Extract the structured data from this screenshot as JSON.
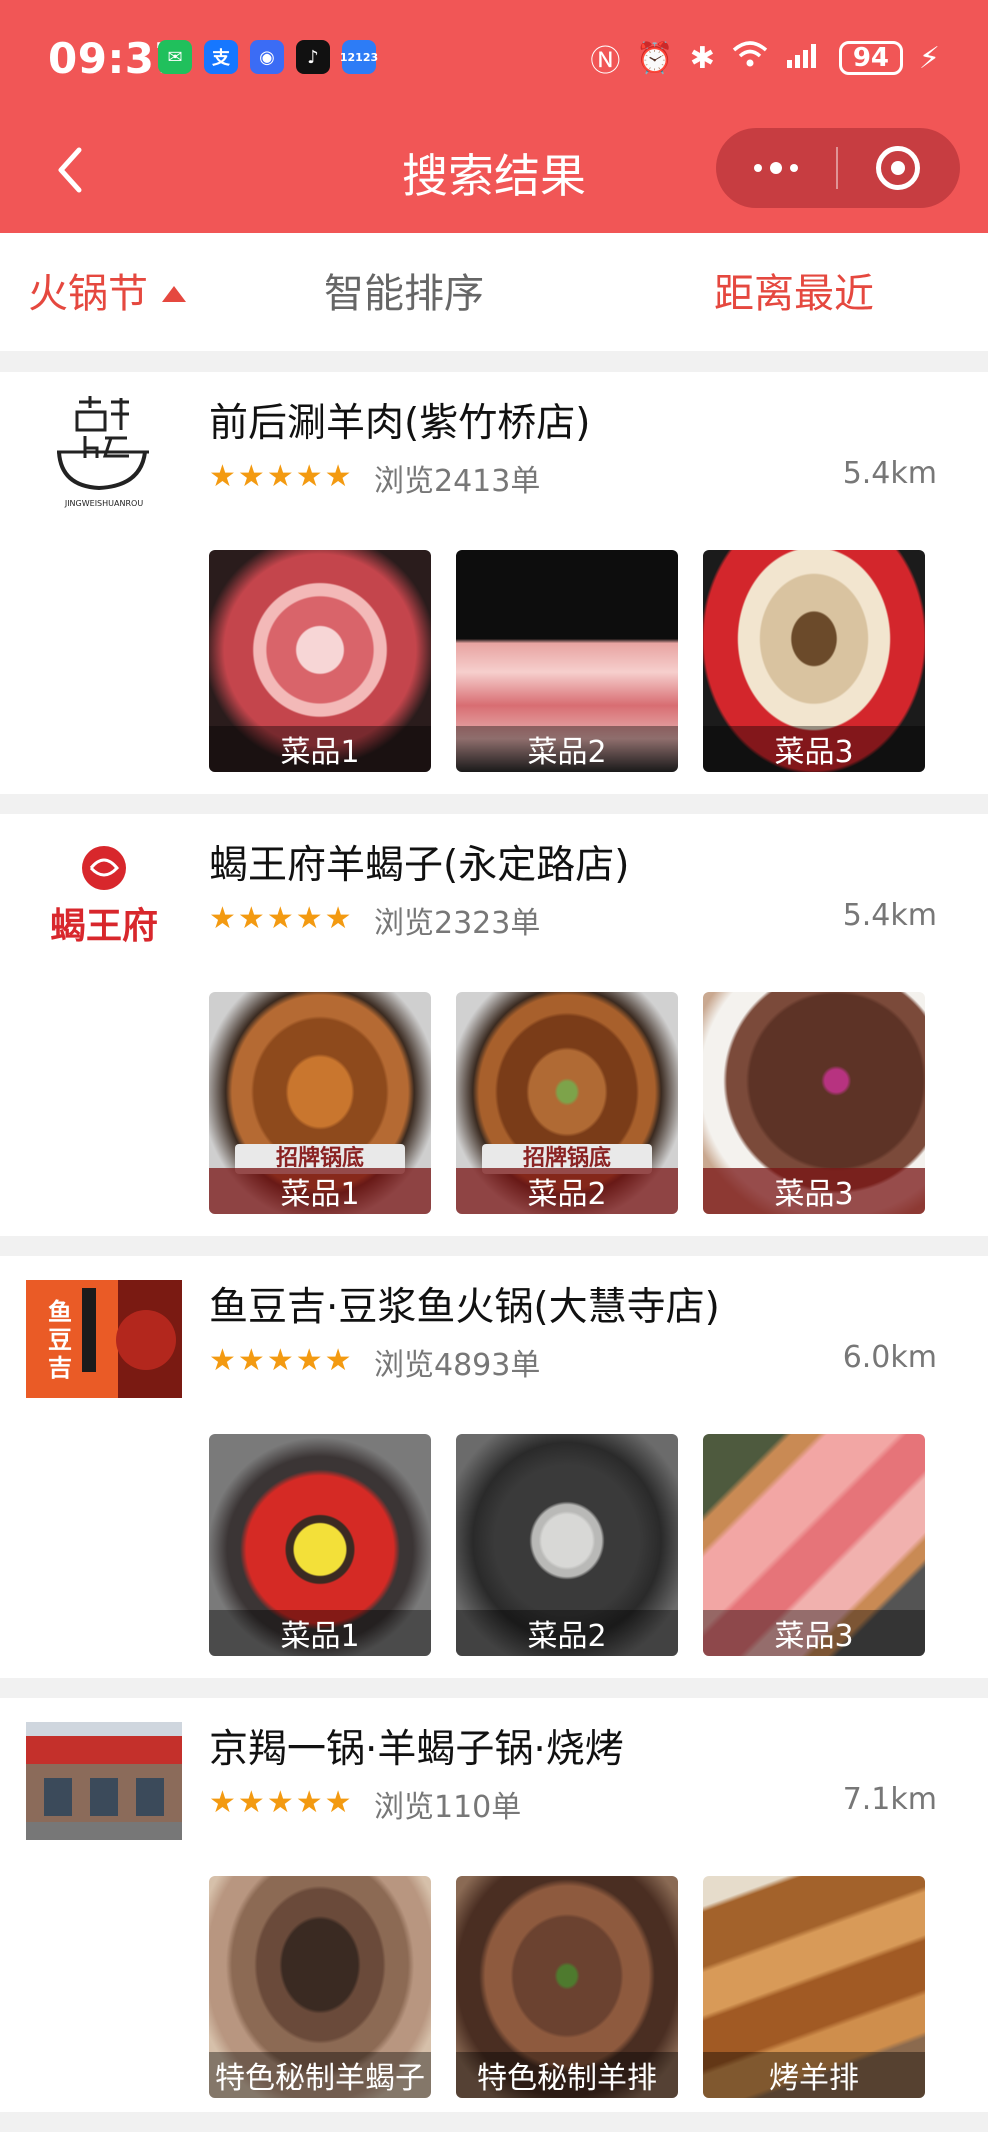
{
  "status_bar": {
    "time": "09:37",
    "app_icons": [
      {
        "icon": "wechat-icon",
        "glyph": "💬",
        "color": "#20c05c"
      },
      {
        "icon": "alipay-icon",
        "glyph": "支",
        "color": "#1677ff"
      },
      {
        "icon": "voice-app-icon",
        "glyph": "◉",
        "color": "#3b6cf5"
      },
      {
        "icon": "tiktok-icon",
        "glyph": "♪",
        "color": "#111111"
      },
      {
        "icon": "traffic-12123-icon",
        "glyph": "12123",
        "color": "#2d7cf6"
      }
    ],
    "battery": "94"
  },
  "nav": {
    "title": "搜索结果"
  },
  "filters": {
    "category": "火锅节",
    "sort": "智能排序",
    "distance": "距离最近"
  },
  "colors": {
    "brand": "#f15656",
    "accent": "#e5483f",
    "star": "#f39a11"
  },
  "restaurants": [
    {
      "name": "前后涮羊肉(紫竹桥店)",
      "rating_stars": 5,
      "views": "浏览2413单",
      "distance": "5.4km",
      "logo_icon": "qianhou-logo",
      "dishes": [
        {
          "label": "菜品1",
          "image": "sliced-lamb-platter"
        },
        {
          "label": "菜品2",
          "image": "lamb-rolls"
        },
        {
          "label": "菜品3",
          "image": "mushroom-hotpot"
        }
      ]
    },
    {
      "name": "蝎王府羊蝎子(永定路店)",
      "rating_stars": 5,
      "views": "浏览2323单",
      "distance": "5.4km",
      "logo_icon": "xiewangfu-logo",
      "logo_text": "蝎王府",
      "dishes": [
        {
          "label": "菜品1",
          "image": "lamb-spine-pot",
          "overlay_text": "招牌锅底"
        },
        {
          "label": "菜品2",
          "image": "lamb-spine-pot",
          "overlay_text": "招牌锅底"
        },
        {
          "label": "菜品3",
          "image": "tripe-platter"
        }
      ]
    },
    {
      "name": "鱼豆吉·豆浆鱼火锅(大慧寺店)",
      "rating_stars": 5,
      "views": "浏览4893单",
      "distance": "6.0km",
      "logo_icon": "yudouji-logo",
      "logo_text": "鱼豆吉",
      "dishes": [
        {
          "label": "菜品1",
          "image": "red-broth-pot"
        },
        {
          "label": "菜品2",
          "image": "fish-paste"
        },
        {
          "label": "菜品3",
          "image": "meat-board"
        }
      ]
    },
    {
      "name": "京羯一锅·羊蝎子锅·烧烤",
      "rating_stars": 5,
      "views": "浏览110单",
      "distance": "7.1km",
      "logo_icon": "storefront-photo",
      "dishes": [
        {
          "label": "特色秘制羊蝎子",
          "image": "braised-spine"
        },
        {
          "label": "特色秘制羊排",
          "image": "braised-ribs"
        },
        {
          "label": "烤羊排",
          "image": "grilled-ribs"
        }
      ]
    }
  ]
}
